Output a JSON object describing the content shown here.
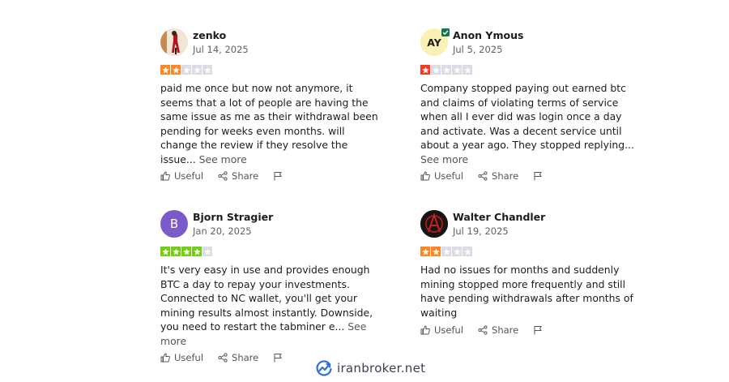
{
  "reviews": [
    {
      "name": "zenko",
      "date": "Jul 14, 2025",
      "rating": 2,
      "star_color": "#ff8622",
      "avatar": {
        "type": "photo",
        "icon": "person-photo-icon",
        "bg": "#d9a36c"
      },
      "text": "paid me once but now not anymore, it seems that a lot of people are having the same issue as me as their withdrawal been pending for weeks even months. will change the review if they resolve the issue...",
      "see_more": "See more",
      "useful": "Useful",
      "share": "Share"
    },
    {
      "name": "Anon Ymous",
      "date": "Jul 5, 2025",
      "rating": 1,
      "star_color": "#ff3722",
      "avatar": {
        "type": "initials",
        "initials": "AY",
        "bg": "#fbf1b7",
        "fg": "#1a1c1f",
        "verified": true
      },
      "text": "Company stopped paying out earned btc and claims of violating terms of service when all I ever did was login once a day and activate. Was a decent service until about a year ago. They stopped replying...",
      "see_more": "See more",
      "useful": "Useful",
      "share": "Share"
    },
    {
      "name": "Bjorn Stragier",
      "date": "Jan 20, 2025",
      "rating": 4,
      "star_color": "#73cf11",
      "avatar": {
        "type": "initials",
        "initials": "B",
        "bg": "#7b5bc9",
        "fg": "#ffffff"
      },
      "text": "It's very easy in use and provides enough BTC a day to repay your investments. Connected to NC wallet, you'll get your mining results almost instantly. Downside, you need to restart the tabminer e...",
      "see_more": "See more",
      "useful": "Useful",
      "share": "Share"
    },
    {
      "name": "Walter Chandler",
      "date": "Jul 19, 2025",
      "rating": 2,
      "star_color": "#ff8622",
      "avatar": {
        "type": "photo",
        "icon": "anarchy-symbol-icon",
        "bg": "#141414"
      },
      "text": "Had no issues for months and suddenly mining stopped more frequently and still have pending withdrawals after months of waiting",
      "see_more": "",
      "useful": "Useful",
      "share": "Share"
    }
  ],
  "empty_star_color": "#dcdce6",
  "watermark": {
    "text": "iranbroker.net",
    "icon": "growth-chart-logo-icon",
    "color": "#2f6fdc"
  }
}
